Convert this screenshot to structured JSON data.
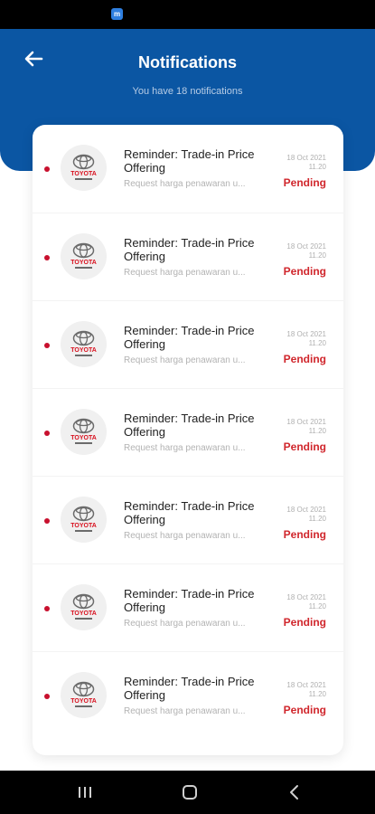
{
  "header": {
    "title": "Notifications",
    "subtitle": "You have 18 notifications"
  },
  "colors": {
    "header_blue": "#0b56a3",
    "unread_dot": "#c8102e",
    "pending": "#d0262c"
  },
  "notifications": [
    {
      "brand": "TOYOTA",
      "title": "Reminder: Trade-in Price Offering",
      "description": "Request harga penawaran u...",
      "date": "18 Oct 2021",
      "time": "11.20",
      "status": "Pending",
      "unread": true
    },
    {
      "brand": "TOYOTA",
      "title": "Reminder: Trade-in Price Offering",
      "description": "Request harga penawaran u...",
      "date": "18 Oct 2021",
      "time": "11.20",
      "status": "Pending",
      "unread": true
    },
    {
      "brand": "TOYOTA",
      "title": "Reminder: Trade-in Price Offering",
      "description": "Request harga penawaran u...",
      "date": "18 Oct 2021",
      "time": "11.20",
      "status": "Pending",
      "unread": true
    },
    {
      "brand": "TOYOTA",
      "title": "Reminder: Trade-in Price Offering",
      "description": "Request harga penawaran u...",
      "date": "18 Oct 2021",
      "time": "11.20",
      "status": "Pending",
      "unread": true
    },
    {
      "brand": "TOYOTA",
      "title": "Reminder: Trade-in Price Offering",
      "description": "Request harga penawaran u...",
      "date": "18 Oct 2021",
      "time": "11.20",
      "status": "Pending",
      "unread": true
    },
    {
      "brand": "TOYOTA",
      "title": "Reminder: Trade-in Price Offering",
      "description": "Request harga penawaran u...",
      "date": "18 Oct 2021",
      "time": "11.20",
      "status": "Pending",
      "unread": true
    },
    {
      "brand": "TOYOTA",
      "title": "Reminder: Trade-in Price Offering",
      "description": "Request harga penawaran u...",
      "date": "18 Oct 2021",
      "time": "11.20",
      "status": "Pending",
      "unread": true
    }
  ],
  "icons": {
    "back": "arrow-left-icon",
    "status_app": "app-notification-icon",
    "nav_recent": "recent-apps-icon",
    "nav_home": "home-icon",
    "nav_back": "chevron-left-icon"
  }
}
